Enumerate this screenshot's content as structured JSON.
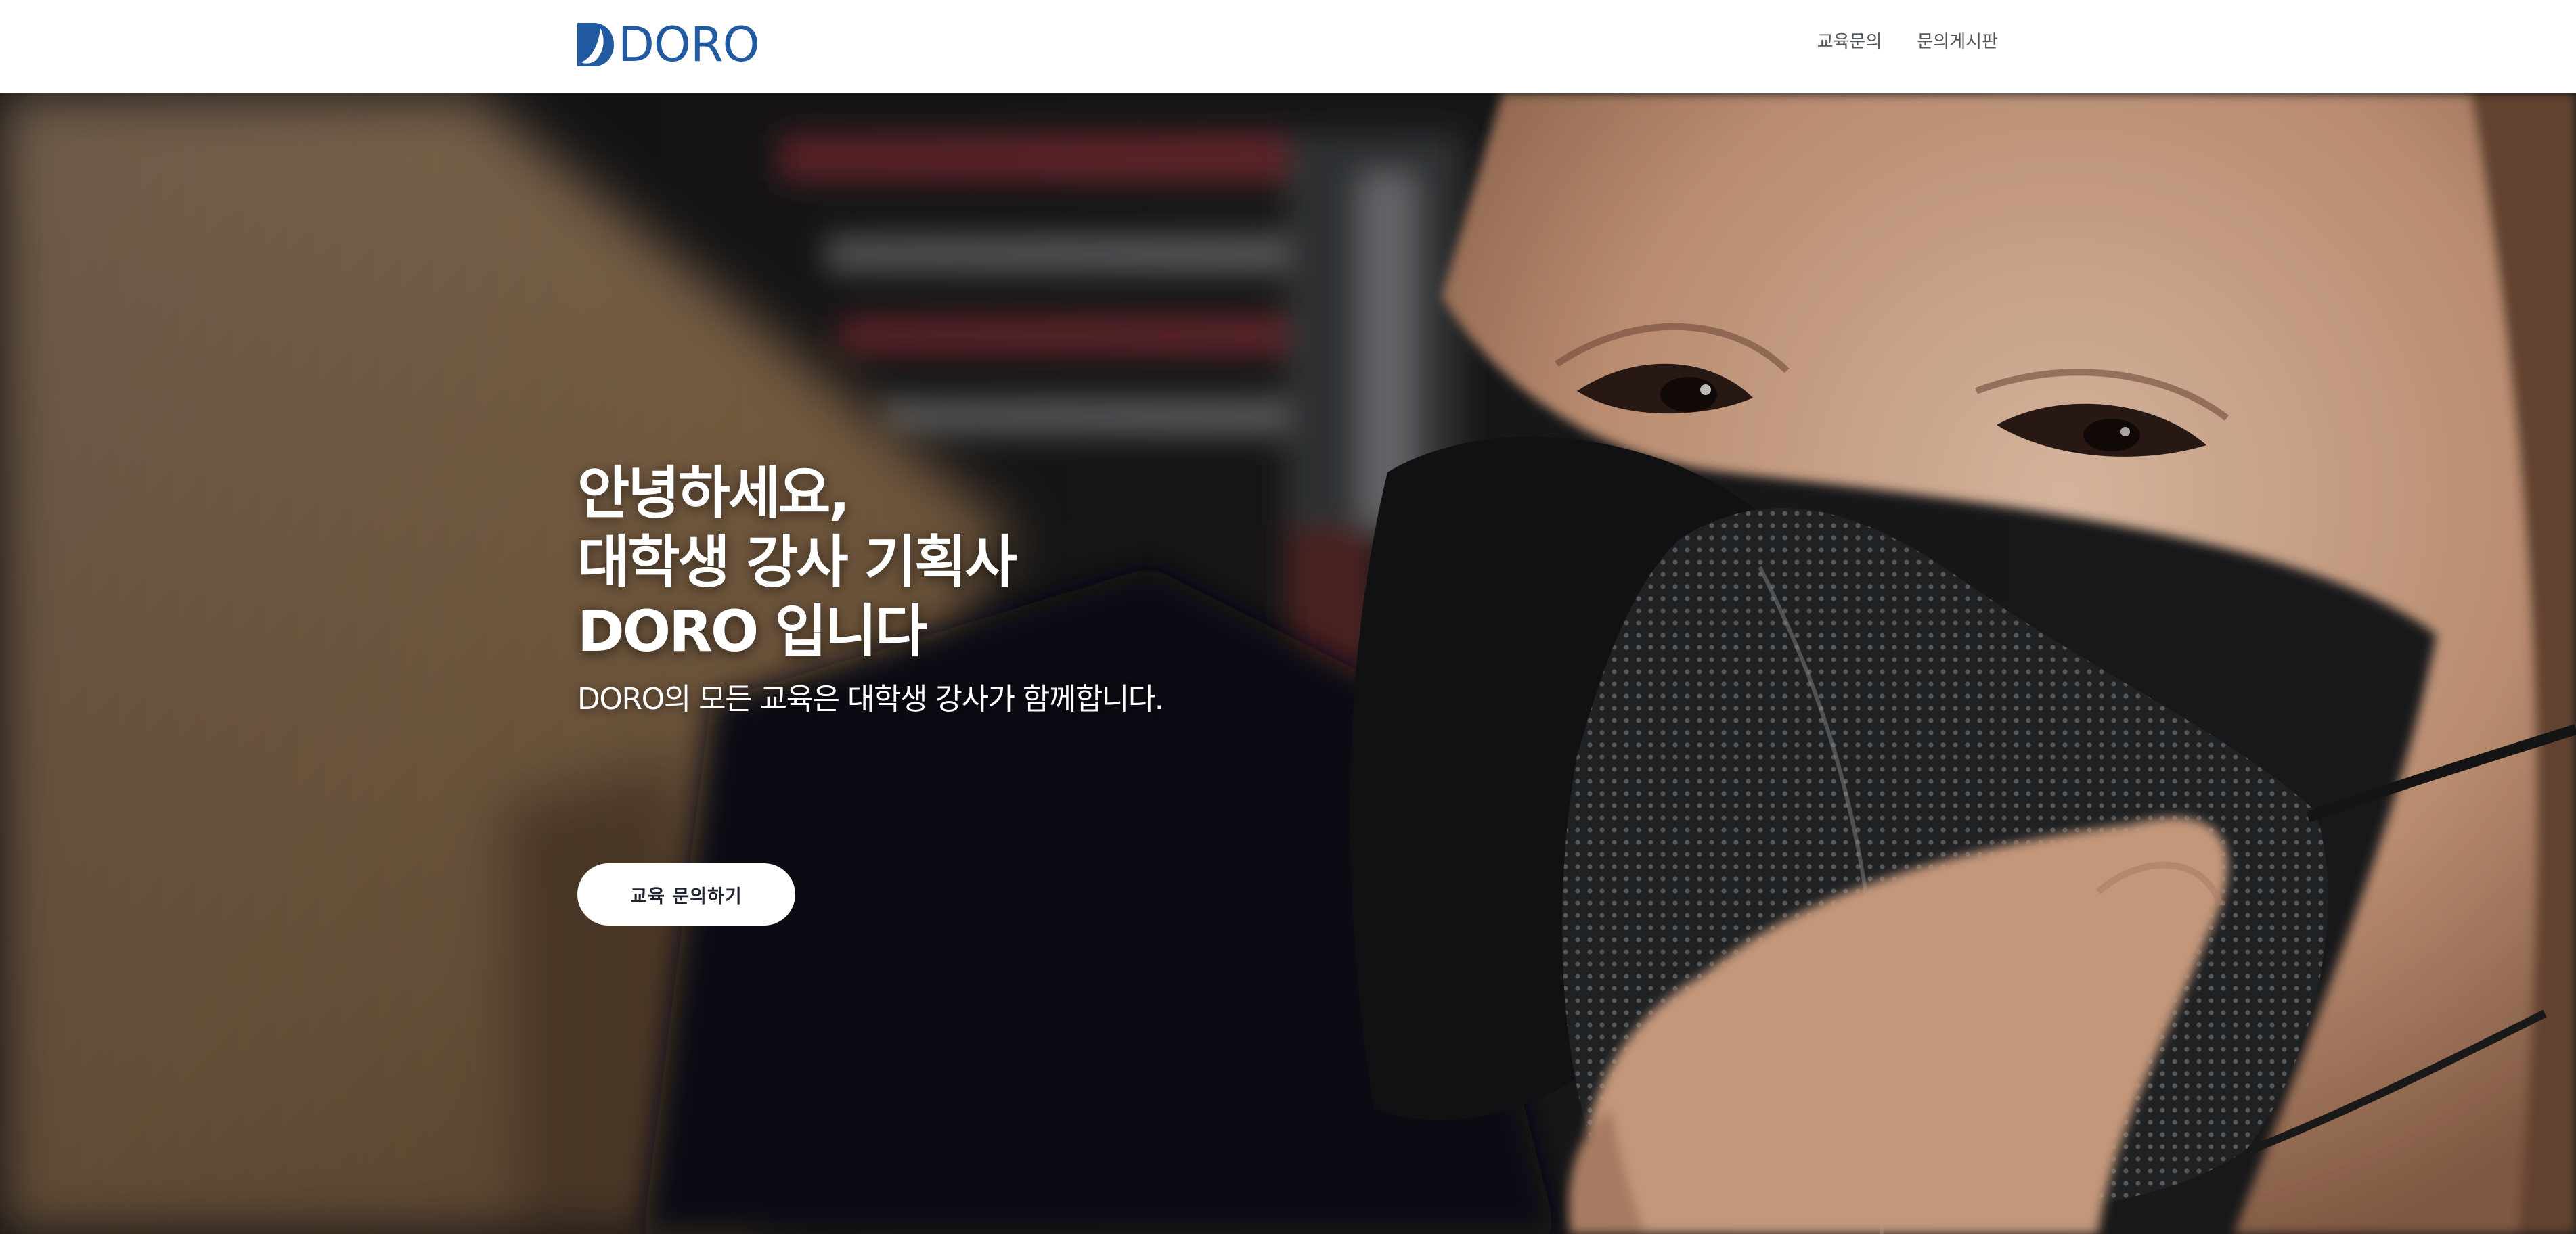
{
  "header": {
    "logo_text": "DORO",
    "brand_color": "#215aa0",
    "nav": [
      {
        "label": "교육문의"
      },
      {
        "label": "문의게시판"
      }
    ]
  },
  "hero": {
    "title_lines": [
      "안녕하세요,",
      "대학생 강사 기획사",
      "DORO 입니다"
    ],
    "subtitle": "DORO의 모든 교육은 대학생 강사가 함께합니다.",
    "cta_label": "교육 문의하기",
    "photo": "smiling student wearing a black face mask giving a thumbs-up"
  }
}
